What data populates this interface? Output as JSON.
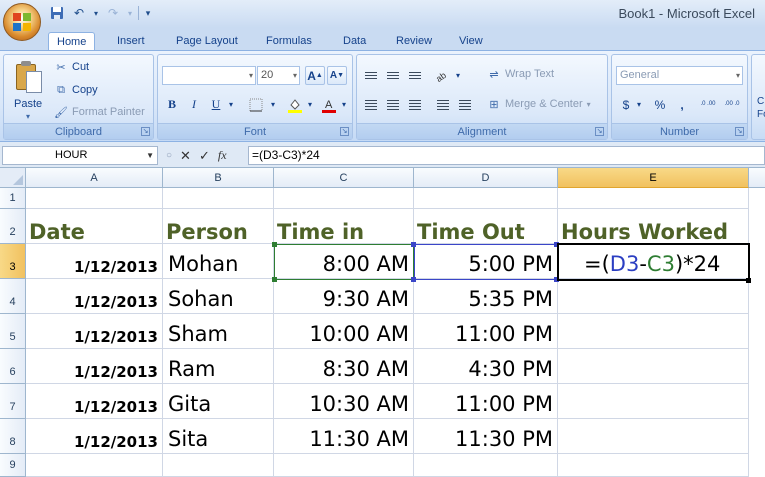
{
  "window": {
    "title": "Book1 - Microsoft Excel"
  },
  "quick_access": {
    "save_icon": "save-icon",
    "undo_icon": "undo-icon",
    "redo_icon": "redo-icon"
  },
  "tabs": [
    "Home",
    "Insert",
    "Page Layout",
    "Formulas",
    "Data",
    "Review",
    "View"
  ],
  "ribbon": {
    "clipboard": {
      "label": "Clipboard",
      "paste": "Paste",
      "cut": "Cut",
      "copy": "Copy",
      "format_painter": "Format Painter"
    },
    "font": {
      "label": "Font",
      "font_name": "",
      "font_size": "20",
      "bold": "B",
      "italic": "I",
      "underline": "U",
      "grow": "A",
      "shrink": "A"
    },
    "alignment": {
      "label": "Alignment",
      "wrap_text": "Wrap Text",
      "merge_center": "Merge & Center"
    },
    "number": {
      "label": "Number",
      "format": "General",
      "currency": "$",
      "percent": "%",
      "comma": ",",
      "inc_decimal": ".0 .00",
      "dec_decimal": ".00 .0"
    },
    "styles": {
      "cond_formatting_partial": "C\nFo"
    }
  },
  "formula_bar": {
    "name_box": "HOUR",
    "cancel": "✕",
    "enter": "✓",
    "fx": "fx",
    "formula": "=(D3-C3)*24"
  },
  "columns": [
    "A",
    "B",
    "C",
    "D",
    "E"
  ],
  "rows": [
    "1",
    "2",
    "3",
    "4",
    "5",
    "6",
    "7",
    "8",
    "9"
  ],
  "sheet": {
    "headers": {
      "date": "Date",
      "person": "Person",
      "time_in": "Time in",
      "time_out": "Time Out",
      "hours": "Hours Worked"
    },
    "records": [
      {
        "date": "1/12/2013",
        "person": "Mohan",
        "time_in": "8:00 AM",
        "time_out": "5:00 PM"
      },
      {
        "date": "1/12/2013",
        "person": "Sohan",
        "time_in": "9:30 AM",
        "time_out": "5:35 PM"
      },
      {
        "date": "1/12/2013",
        "person": "Sham",
        "time_in": "10:00 AM",
        "time_out": "11:00 PM"
      },
      {
        "date": "1/12/2013",
        "person": "Ram",
        "time_in": "8:30 AM",
        "time_out": "4:30 PM"
      },
      {
        "date": "1/12/2013",
        "person": "Gita",
        "time_in": "10:30 AM",
        "time_out": "11:00 PM"
      },
      {
        "date": "1/12/2013",
        "person": "Sita",
        "time_in": "11:30 AM",
        "time_out": "11:30 PM"
      }
    ],
    "editing_formula": {
      "prefix": "=(",
      "ref1": "D3",
      "minus": "-",
      "ref2": "C3",
      "suffix": ")*24"
    }
  },
  "colors": {
    "header_text": "#4f6228",
    "ref_d3": "#2b3ec2",
    "ref_c3": "#2e7d32",
    "selected_header": "#f1c15f"
  }
}
